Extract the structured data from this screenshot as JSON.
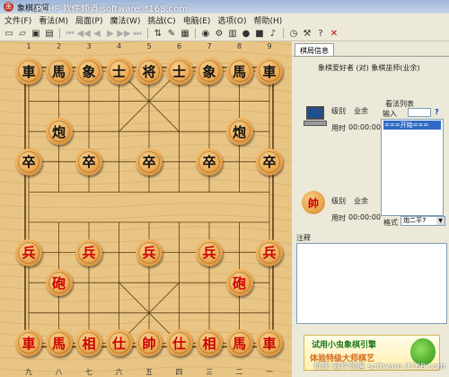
{
  "window": {
    "title": "象棋巫师",
    "watermark_top": "PCHF 软件频道 software.it168.com",
    "watermark_bottom": "你的·软件频道 software.it168.com"
  },
  "menu": [
    "文件(F)",
    "看法(M)",
    "局面(P)",
    "魔法(W)",
    "挑战(C)",
    "电脑(E)",
    "选项(O)",
    "帮助(H)"
  ],
  "toolbar": {
    "icons": [
      "new-icon",
      "open-icon",
      "save-icon",
      "print-icon",
      "first-icon",
      "prev-icon",
      "prev-step-icon",
      "next-step-icon",
      "next-icon",
      "last-icon",
      "flip-icon",
      "edit-icon",
      "computer-icon",
      "engine-icon",
      "analyze-icon",
      "board-icon",
      "piece-icon",
      "stop-icon",
      "sound-icon",
      "clock-icon",
      "settings-icon",
      "help-icon",
      "close-icon"
    ]
  },
  "board": {
    "col_top": [
      "1",
      "2",
      "3",
      "4",
      "5",
      "6",
      "7",
      "8",
      "9"
    ],
    "col_bottom": [
      "九",
      "八",
      "七",
      "六",
      "五",
      "四",
      "三",
      "二",
      "一"
    ],
    "black_pieces": [
      {
        "c": 0,
        "r": 0,
        "t": "車"
      },
      {
        "c": 1,
        "r": 0,
        "t": "馬"
      },
      {
        "c": 2,
        "r": 0,
        "t": "象"
      },
      {
        "c": 3,
        "r": 0,
        "t": "士"
      },
      {
        "c": 4,
        "r": 0,
        "t": "将"
      },
      {
        "c": 5,
        "r": 0,
        "t": "士"
      },
      {
        "c": 6,
        "r": 0,
        "t": "象"
      },
      {
        "c": 7,
        "r": 0,
        "t": "馬"
      },
      {
        "c": 8,
        "r": 0,
        "t": "車"
      },
      {
        "c": 1,
        "r": 2,
        "t": "炮"
      },
      {
        "c": 7,
        "r": 2,
        "t": "炮"
      },
      {
        "c": 0,
        "r": 3,
        "t": "卒"
      },
      {
        "c": 2,
        "r": 3,
        "t": "卒"
      },
      {
        "c": 4,
        "r": 3,
        "t": "卒"
      },
      {
        "c": 6,
        "r": 3,
        "t": "卒"
      },
      {
        "c": 8,
        "r": 3,
        "t": "卒"
      }
    ],
    "red_pieces": [
      {
        "c": 0,
        "r": 6,
        "t": "兵"
      },
      {
        "c": 2,
        "r": 6,
        "t": "兵"
      },
      {
        "c": 4,
        "r": 6,
        "t": "兵"
      },
      {
        "c": 6,
        "r": 6,
        "t": "兵"
      },
      {
        "c": 8,
        "r": 6,
        "t": "兵"
      },
      {
        "c": 1,
        "r": 7,
        "t": "砲"
      },
      {
        "c": 7,
        "r": 7,
        "t": "砲"
      },
      {
        "c": 0,
        "r": 9,
        "t": "車"
      },
      {
        "c": 1,
        "r": 9,
        "t": "馬"
      },
      {
        "c": 2,
        "r": 9,
        "t": "相"
      },
      {
        "c": 3,
        "r": 9,
        "t": "仕"
      },
      {
        "c": 4,
        "r": 9,
        "t": "帥"
      },
      {
        "c": 5,
        "r": 9,
        "t": "仕"
      },
      {
        "c": 6,
        "r": 9,
        "t": "相"
      },
      {
        "c": 7,
        "r": 9,
        "t": "馬"
      },
      {
        "c": 8,
        "r": 9,
        "t": "車"
      }
    ]
  },
  "panel": {
    "tab": "棋局信息",
    "vs_text": "象棋爱好者 (对) 象棋巫师(业余)",
    "top_player": {
      "level_label": "级别",
      "level": "业余",
      "time_label": "用时",
      "time": "00:00:00"
    },
    "bottom_player": {
      "avatar": "帥",
      "level_label": "级别",
      "level": "业余",
      "time_label": "用时",
      "time": "00:00:00"
    },
    "moves": {
      "title": "看法列表",
      "input_label": "输入",
      "help": "?",
      "first_item": "===开始===",
      "format_label": "格式",
      "format_value": "炮二平7"
    },
    "notes_label": "注释",
    "ad": {
      "line1": "试用小虫象棋引擎",
      "line2": "体验特级大师棋艺"
    }
  }
}
